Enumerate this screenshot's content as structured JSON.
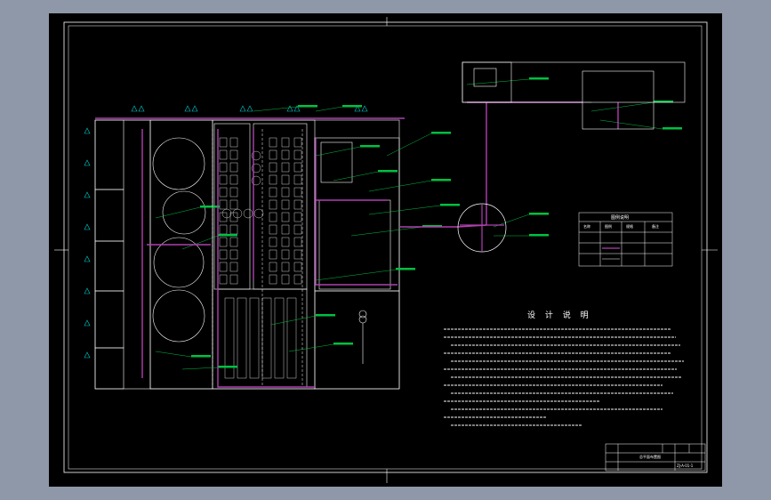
{
  "drawing": {
    "notes_title": "设 计 说 明",
    "legend_title": "图例说明",
    "legend_headers": [
      "名称",
      "图例",
      "规格",
      "备注"
    ],
    "title_block": {
      "drawing_name": "总平面布置图",
      "drawing_number": "ZJ-A-01-1"
    }
  },
  "colors": {
    "sheet_bg": "#000000",
    "frame": "#ffffff",
    "pipe": "#b040b0",
    "equipment": "#ffffff",
    "annotation": "#00c040",
    "cyan_marks": "#00c8c8"
  },
  "icons": [
    "transformer-symbol-icon",
    "tree-symbol-icon"
  ]
}
